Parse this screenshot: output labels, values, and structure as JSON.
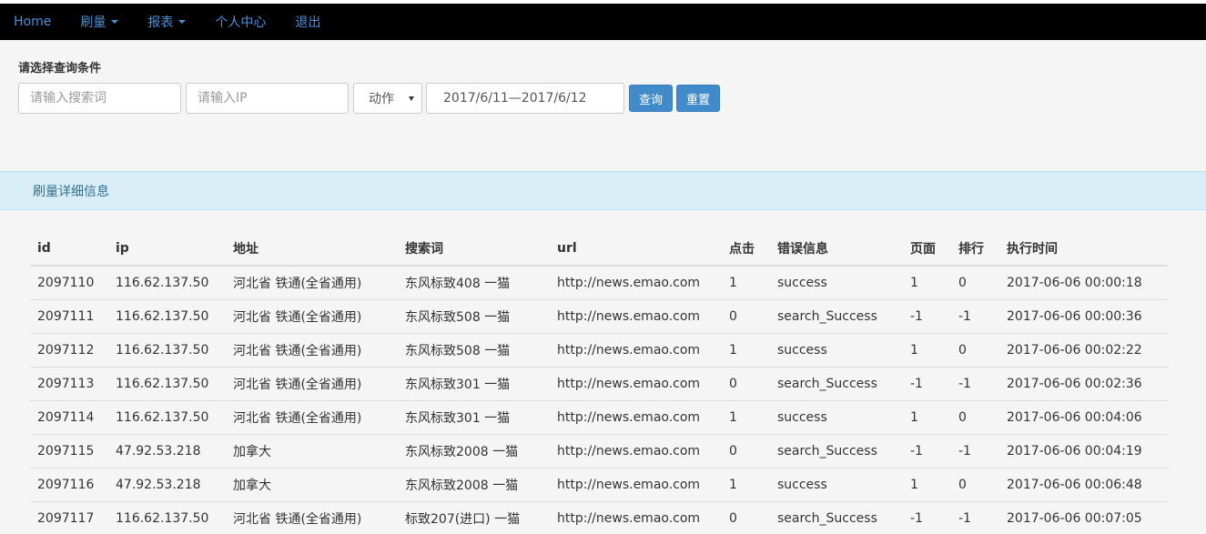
{
  "nav": {
    "items": [
      {
        "label": "Home",
        "dropdown": false
      },
      {
        "label": "刷量",
        "dropdown": true
      },
      {
        "label": "报表",
        "dropdown": true
      },
      {
        "label": "个人中心",
        "dropdown": false
      },
      {
        "label": "退出",
        "dropdown": false
      }
    ]
  },
  "filter": {
    "title": "请选择查询条件",
    "keyword_placeholder": "请输入搜索词",
    "ip_placeholder": "请输入IP",
    "action_select": "动作",
    "date_range": "2017/6/11—2017/6/12",
    "query_label": "查询",
    "reset_label": "重置"
  },
  "panel": {
    "title": "刷量详细信息"
  },
  "table": {
    "columns": [
      "id",
      "ip",
      "地址",
      "搜索词",
      "url",
      "点击",
      "错误信息",
      "页面",
      "排行",
      "执行时间"
    ],
    "rows": [
      [
        "2097110",
        "116.62.137.50",
        "河北省 铁通(全省通用)",
        "东风标致408 一猫",
        "http://news.emao.com",
        "1",
        "success",
        "1",
        "0",
        "2017-06-06 00:00:18"
      ],
      [
        "2097111",
        "116.62.137.50",
        "河北省 铁通(全省通用)",
        "东风标致508 一猫",
        "http://news.emao.com",
        "0",
        "search_Success",
        "-1",
        "-1",
        "2017-06-06 00:00:36"
      ],
      [
        "2097112",
        "116.62.137.50",
        "河北省 铁通(全省通用)",
        "东风标致508 一猫",
        "http://news.emao.com",
        "1",
        "success",
        "1",
        "0",
        "2017-06-06 00:02:22"
      ],
      [
        "2097113",
        "116.62.137.50",
        "河北省 铁通(全省通用)",
        "东风标致301 一猫",
        "http://news.emao.com",
        "0",
        "search_Success",
        "-1",
        "-1",
        "2017-06-06 00:02:36"
      ],
      [
        "2097114",
        "116.62.137.50",
        "河北省 铁通(全省通用)",
        "东风标致301 一猫",
        "http://news.emao.com",
        "1",
        "success",
        "1",
        "0",
        "2017-06-06 00:04:06"
      ],
      [
        "2097115",
        "47.92.53.218",
        "加拿大",
        "东风标致2008 一猫",
        "http://news.emao.com",
        "0",
        "search_Success",
        "-1",
        "-1",
        "2017-06-06 00:04:19"
      ],
      [
        "2097116",
        "47.92.53.218",
        "加拿大",
        "东风标致2008 一猫",
        "http://news.emao.com",
        "1",
        "success",
        "1",
        "0",
        "2017-06-06 00:06:48"
      ],
      [
        "2097117",
        "116.62.137.50",
        "河北省 铁通(全省通用)",
        "标致207(进口) 一猫",
        "http://news.emao.com",
        "0",
        "search_Success",
        "-1",
        "-1",
        "2017-06-06 00:07:05"
      ]
    ]
  },
  "colors": {
    "navbar_bg": "#000000",
    "nav_link": "#4a90d9",
    "button_primary": "#428bca",
    "panel_heading_bg": "#d9edf7",
    "panel_heading_text": "#31708f"
  }
}
